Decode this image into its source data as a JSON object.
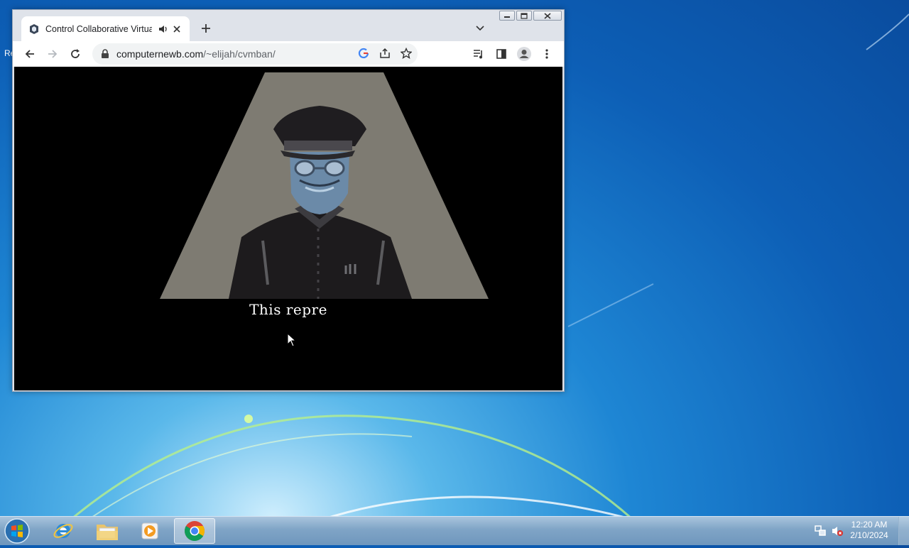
{
  "desktop": {
    "partial_icon_label": "Re"
  },
  "browser": {
    "tab": {
      "title": "Control Collaborative Virtual",
      "audio_icon": "speaker-icon"
    },
    "toolbar": {
      "url_host": "computernewb.com",
      "url_path": "/~elijah/cvmban/"
    },
    "content": {
      "caption": "This repre"
    }
  },
  "taskbar": {
    "apps": [
      "start",
      "internet-explorer",
      "file-explorer",
      "media-player",
      "chrome"
    ],
    "clock_time": "12:20 AM",
    "clock_date": "2/10/2024"
  }
}
